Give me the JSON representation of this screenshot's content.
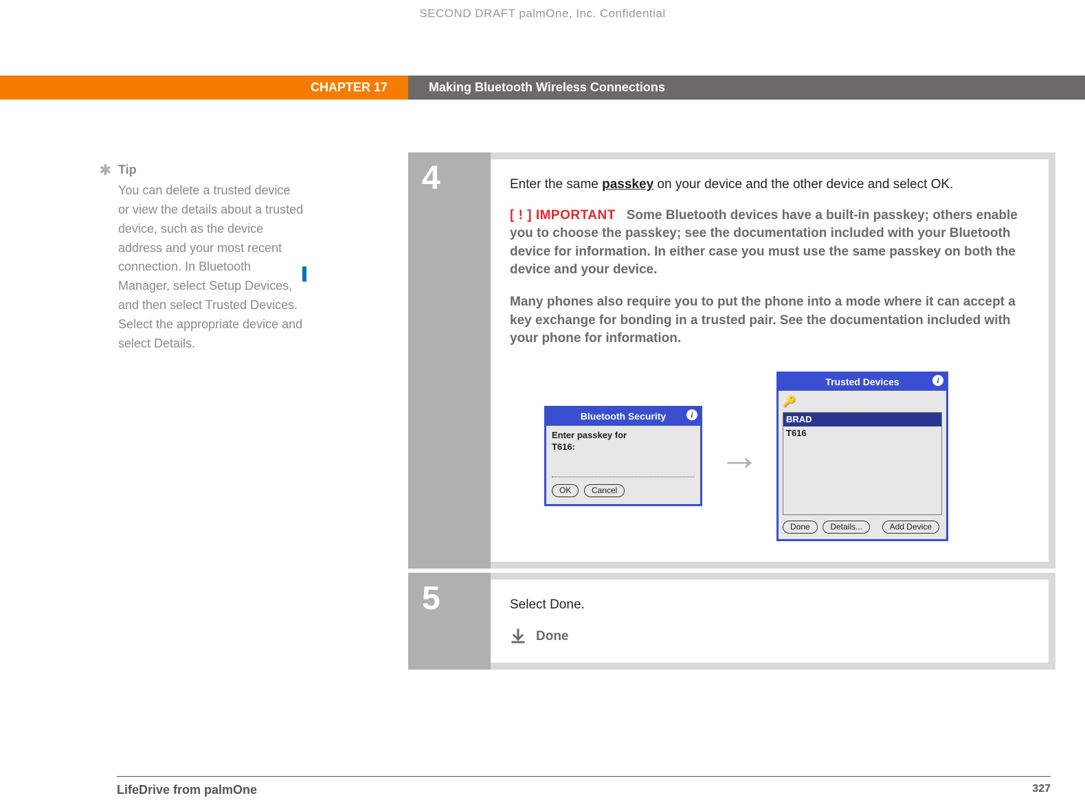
{
  "watermark": "SECOND DRAFT palmOne, Inc.  Confidential",
  "chapter": {
    "label": "CHAPTER 17",
    "title": "Making Bluetooth Wireless Connections"
  },
  "tip": {
    "heading": "Tip",
    "body": "You can delete a trusted device or view the details about a trusted device, such as the device address and your most recent connection. In Bluetooth Manager, select Setup Devices, and then select Trusted Devices. Select the appropriate device and select Details."
  },
  "step4": {
    "num": "4",
    "intro_pre": "Enter the same ",
    "passkey_word": "passkey",
    "intro_post": " on your device and the other device and select OK.",
    "important_tag": "IMPORTANT",
    "important_text": "Some Bluetooth devices have a built-in passkey; others enable you to choose the passkey; see the documentation included with your Bluetooth device for information. In either case you must use the same passkey on both the device and your device.",
    "phone_text": "Many phones also require you to put the phone into a mode where it can accept a key exchange for bonding in a trusted pair. See the documentation included with your phone for information."
  },
  "bt_security": {
    "title": "Bluetooth Security",
    "prompt_l1": "Enter passkey for",
    "prompt_l2": "T616:",
    "ok": "OK",
    "cancel": "Cancel"
  },
  "trusted": {
    "title": "Trusted Devices",
    "items": [
      "BRAD",
      "T616"
    ],
    "done": "Done",
    "details": "Details...",
    "add": "Add Device"
  },
  "step5": {
    "num": "5",
    "text": "Select Done.",
    "done_label": "Done"
  },
  "footer": {
    "left": "LifeDrive from palmOne",
    "page": "327"
  }
}
